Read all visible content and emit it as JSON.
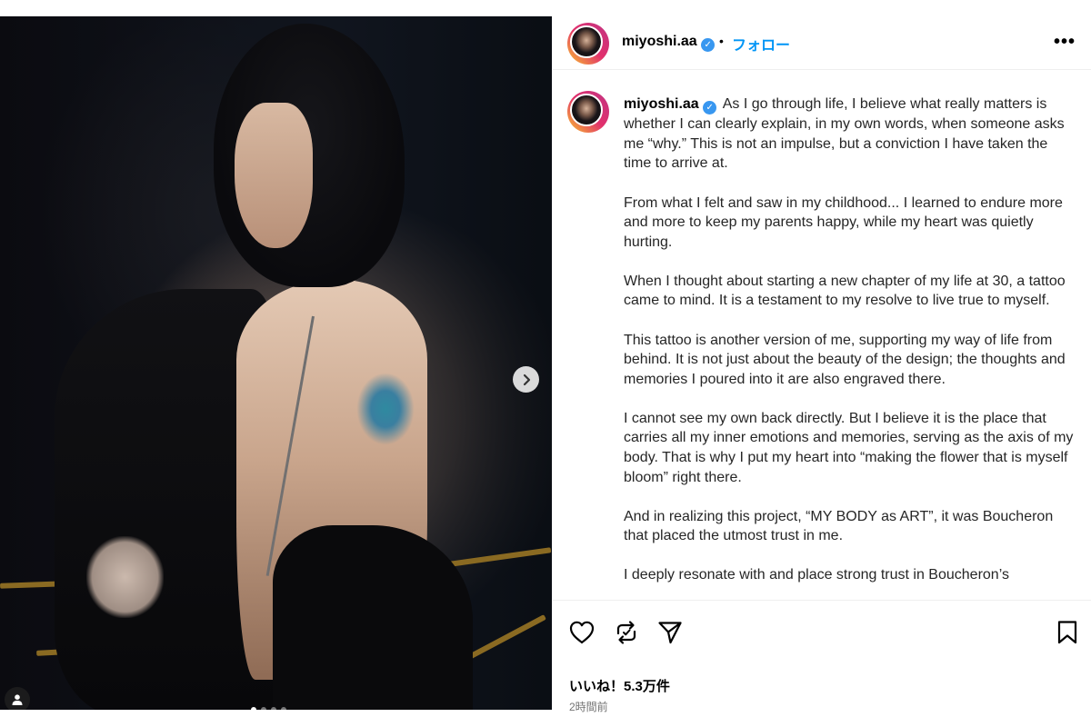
{
  "post": {
    "username": "miyoshi.aa",
    "separator": "•",
    "follow_label": "フォロー",
    "more_label": "•••",
    "verified_mark": "✓",
    "media": {
      "slide_count": 4,
      "active_slide": 1
    },
    "caption": {
      "username": "miyoshi.aa",
      "paragraphs": [
        "As I go through life, I believe what really matters is whether I can clearly explain, in my own words, when someone asks me “why.”  This is not an impulse, but a conviction I have taken the time to arrive at.",
        "From what I felt and saw in my childhood... I learned to endure more and more to keep my parents happy, while my heart was quietly hurting.",
        "When I thought about starting a new chapter of my life at 30, a tattoo came to mind. It is a testament to my resolve to live true to myself.",
        "This tattoo is another version of me, supporting my way of life from behind. It is not just about the beauty of the design; the thoughts and memories I poured into it are also engraved there.",
        "I cannot see my own back directly. But I believe it is the place that carries all my inner emotions and memories, serving as the axis of my body. That is why I put my heart into “making the flower that is myself bloom” right there.",
        "And in realizing this project, “MY BODY as ART”, it was Boucheron that placed the utmost trust in me.",
        "I deeply resonate with and place strong trust in Boucheron’s"
      ]
    },
    "likes_text": "いいね！5.3万件",
    "time_text": "2時間前",
    "icons": {
      "like": "heart-icon",
      "repost": "repost-icon",
      "share": "send-icon",
      "save": "bookmark-icon",
      "next": "chevron-right-icon",
      "tagged": "user-icon"
    },
    "colors": {
      "follow": "#0095f6",
      "verified": "#3897f0"
    }
  }
}
